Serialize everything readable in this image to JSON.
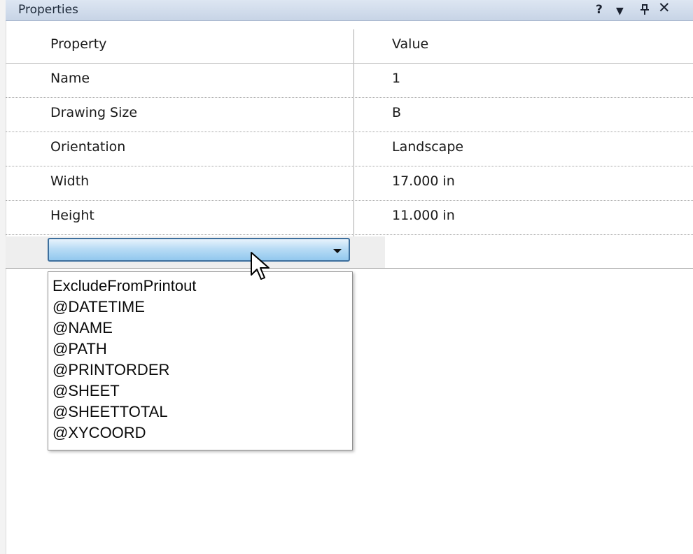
{
  "panel": {
    "title": "Properties",
    "help_label": "?",
    "menu_label": "▼",
    "pin_label": "†",
    "close_label": "✕"
  },
  "grid": {
    "header": {
      "property": "Property",
      "value": "Value"
    },
    "rows": [
      {
        "property": "Name",
        "value": "1"
      },
      {
        "property": "Drawing Size",
        "value": "B"
      },
      {
        "property": "Orientation",
        "value": "Landscape"
      },
      {
        "property": "Width",
        "value": "17.000 in"
      },
      {
        "property": "Height",
        "value": "11.000 in"
      }
    ]
  },
  "combo": {
    "value": "",
    "options": [
      "ExcludeFromPrintout",
      "@DATETIME",
      "@NAME",
      "@PATH",
      "@PRINTORDER",
      "@SHEET",
      "@SHEETTOTAL",
      "@XYCOORD"
    ]
  },
  "icons": {
    "combo_arrow": "chevron-down-icon",
    "cursor": "mouse-pointer-icon"
  },
  "colors": {
    "titlebar": "#c7d4e6",
    "combo_border": "#3d6f9d",
    "combo_fill": "#b9dcf5",
    "edit_row": "#eeeeee"
  }
}
